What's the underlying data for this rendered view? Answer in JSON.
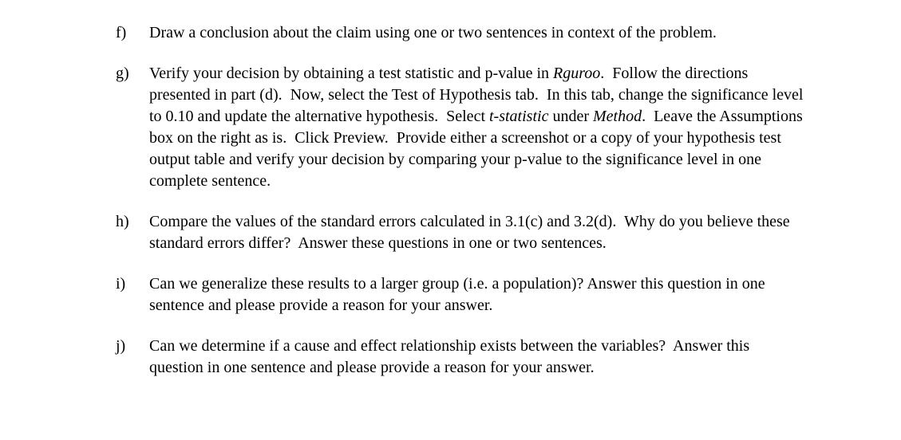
{
  "items": [
    {
      "marker": "f)",
      "html": "Draw a conclusion about the claim using one or two sentences in context of the problem."
    },
    {
      "marker": "g)",
      "html": "Verify your decision by obtaining a test statistic and p-value in <i>Rguroo</i>.&nbsp; Follow the directions presented in part (d).&nbsp; Now, select the Test of Hypothesis tab.&nbsp; In this tab, change the significance level to 0.10 and update the alternative hypothesis.&nbsp; Select <i>t-statistic</i> under <i>Method</i>.&nbsp; Leave the Assumptions box on the right as is.&nbsp; Click Preview.&nbsp; Provide either a screenshot or a copy of your hypothesis test output table and verify your decision by comparing your p-value to the significance level in one complete sentence."
    },
    {
      "marker": "h)",
      "html": "Compare the values of the standard errors calculated in 3.1(c) and 3.2(d).&nbsp; Why do you believe these standard errors differ?&nbsp; Answer these questions in one or two sentences."
    },
    {
      "marker": "i)",
      "html": "Can we generalize these results to a larger group (i.e. a population)? Answer this question in one sentence and please provide a reason for your answer."
    },
    {
      "marker": "j)",
      "html": "Can we determine if a cause and effect relationship exists between the variables?&nbsp; Answer this question in one sentence and please provide a reason for your answer."
    }
  ]
}
